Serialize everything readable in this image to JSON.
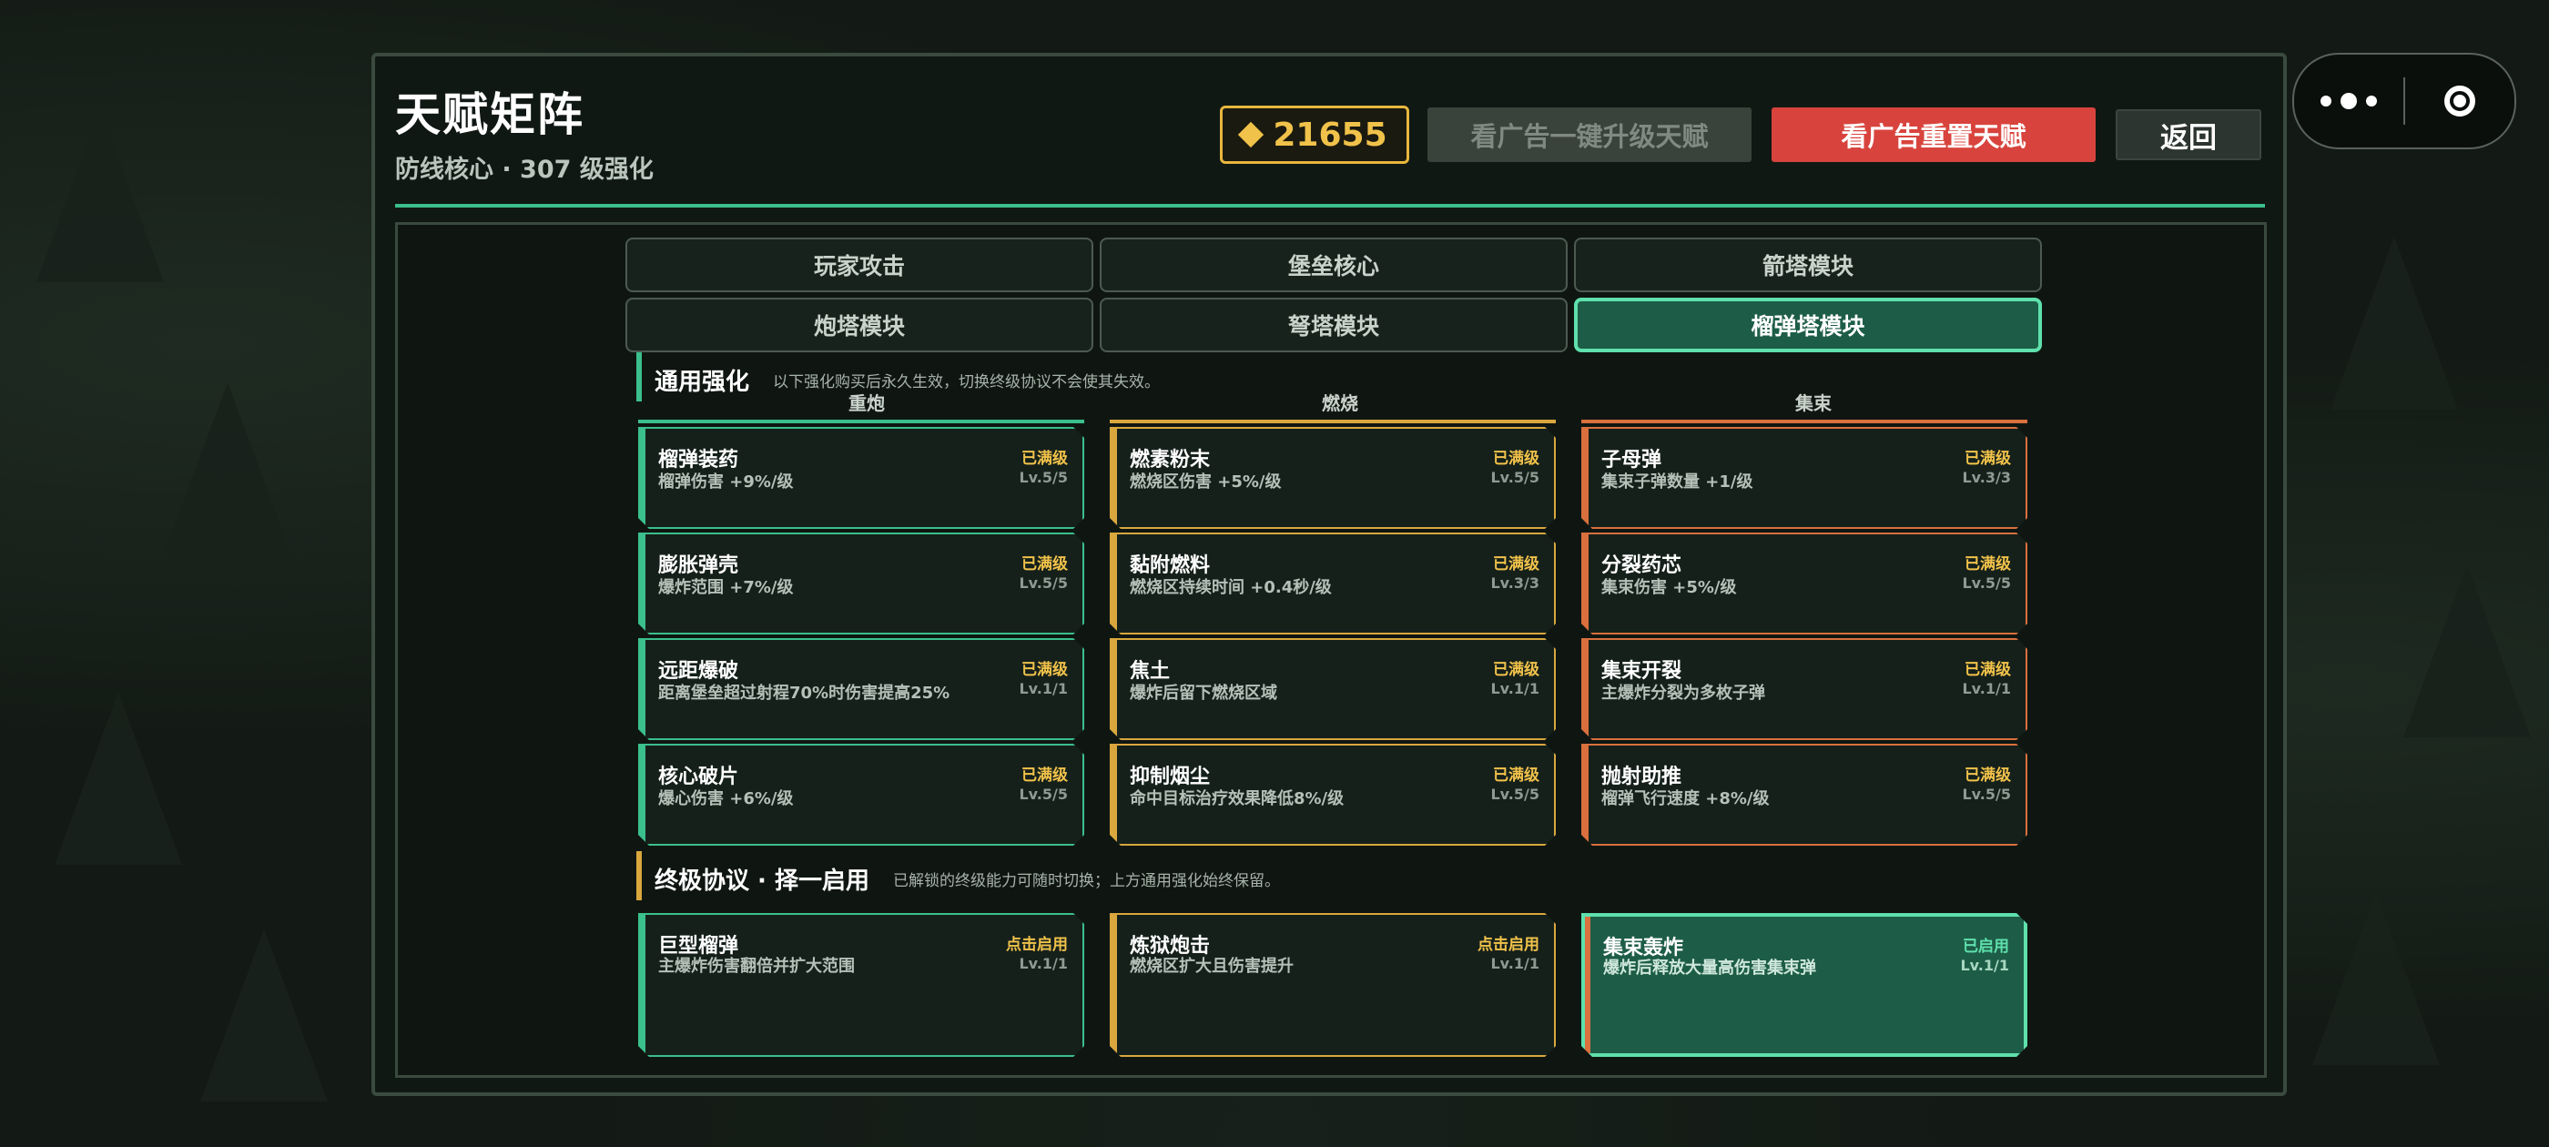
{
  "header": {
    "title": "天赋矩阵",
    "subtitle": "防线核心 · 307 级强化",
    "coins": "21655",
    "upgrade_button": "看广告一键升级天赋",
    "reset_button": "看广告重置天赋",
    "back_button": "返回"
  },
  "tabs": [
    {
      "label": "玩家攻击"
    },
    {
      "label": "堡垒核心"
    },
    {
      "label": "箭塔模块"
    },
    {
      "label": "炮塔模块"
    },
    {
      "label": "弩塔模块"
    },
    {
      "label": "榴弹塔模块",
      "active": true
    }
  ],
  "general": {
    "title": "通用强化",
    "note": "以下强化购买后永久生效，切换终级协议不会使其失效。",
    "columns": [
      "重炮",
      "燃烧",
      "集束"
    ],
    "cards": [
      [
        {
          "name": "榴弹装药",
          "desc": "榴弹伤害 +9%/级",
          "status": "已满级",
          "level": "Lv.5/5"
        },
        {
          "name": "膨胀弹壳",
          "desc": "爆炸范围 +7%/级",
          "status": "已满级",
          "level": "Lv.5/5"
        },
        {
          "name": "远距爆破",
          "desc": "距离堡垒超过射程70%时伤害提高25%",
          "status": "已满级",
          "level": "Lv.1/1"
        },
        {
          "name": "核心破片",
          "desc": "爆心伤害 +6%/级",
          "status": "已满级",
          "level": "Lv.5/5"
        }
      ],
      [
        {
          "name": "燃素粉末",
          "desc": "燃烧区伤害 +5%/级",
          "status": "已满级",
          "level": "Lv.5/5"
        },
        {
          "name": "黏附燃料",
          "desc": "燃烧区持续时间 +0.4秒/级",
          "status": "已满级",
          "level": "Lv.3/3"
        },
        {
          "name": "焦土",
          "desc": "爆炸后留下燃烧区域",
          "status": "已满级",
          "level": "Lv.1/1"
        },
        {
          "name": "抑制烟尘",
          "desc": "命中目标治疗效果降低8%/级",
          "status": "已满级",
          "level": "Lv.5/5"
        }
      ],
      [
        {
          "name": "子母弹",
          "desc": "集束子弹数量 +1/级",
          "status": "已满级",
          "level": "Lv.3/3"
        },
        {
          "name": "分裂药芯",
          "desc": "集束伤害 +5%/级",
          "status": "已满级",
          "level": "Lv.5/5"
        },
        {
          "name": "集束开裂",
          "desc": "主爆炸分裂为多枚子弹",
          "status": "已满级",
          "level": "Lv.1/1"
        },
        {
          "name": "抛射助推",
          "desc": "榴弹飞行速度 +8%/级",
          "status": "已满级",
          "level": "Lv.5/5"
        }
      ]
    ]
  },
  "ultimate": {
    "title": "终极协议 · 择一启用",
    "note": "已解锁的终级能力可随时切换；上方通用强化始终保留。",
    "cards": [
      {
        "name": "巨型榴弹",
        "desc": "主爆炸伤害翻倍并扩大范围",
        "status": "点击启用",
        "level": "Lv.1/1"
      },
      {
        "name": "炼狱炮击",
        "desc": "燃烧区扩大且伤害提升",
        "status": "点击启用",
        "level": "Lv.1/1"
      },
      {
        "name": "集束轰炸",
        "desc": "爆炸后释放大量高伤害集束弹",
        "status": "已启用",
        "level": "Lv.1/1"
      }
    ]
  },
  "colors": {
    "accent_green": "#3bbf8c",
    "accent_gold": "#d9a73d",
    "accent_orange": "#d9703d",
    "reset_red": "#d8443d",
    "coin_gold": "#f1c24a"
  }
}
